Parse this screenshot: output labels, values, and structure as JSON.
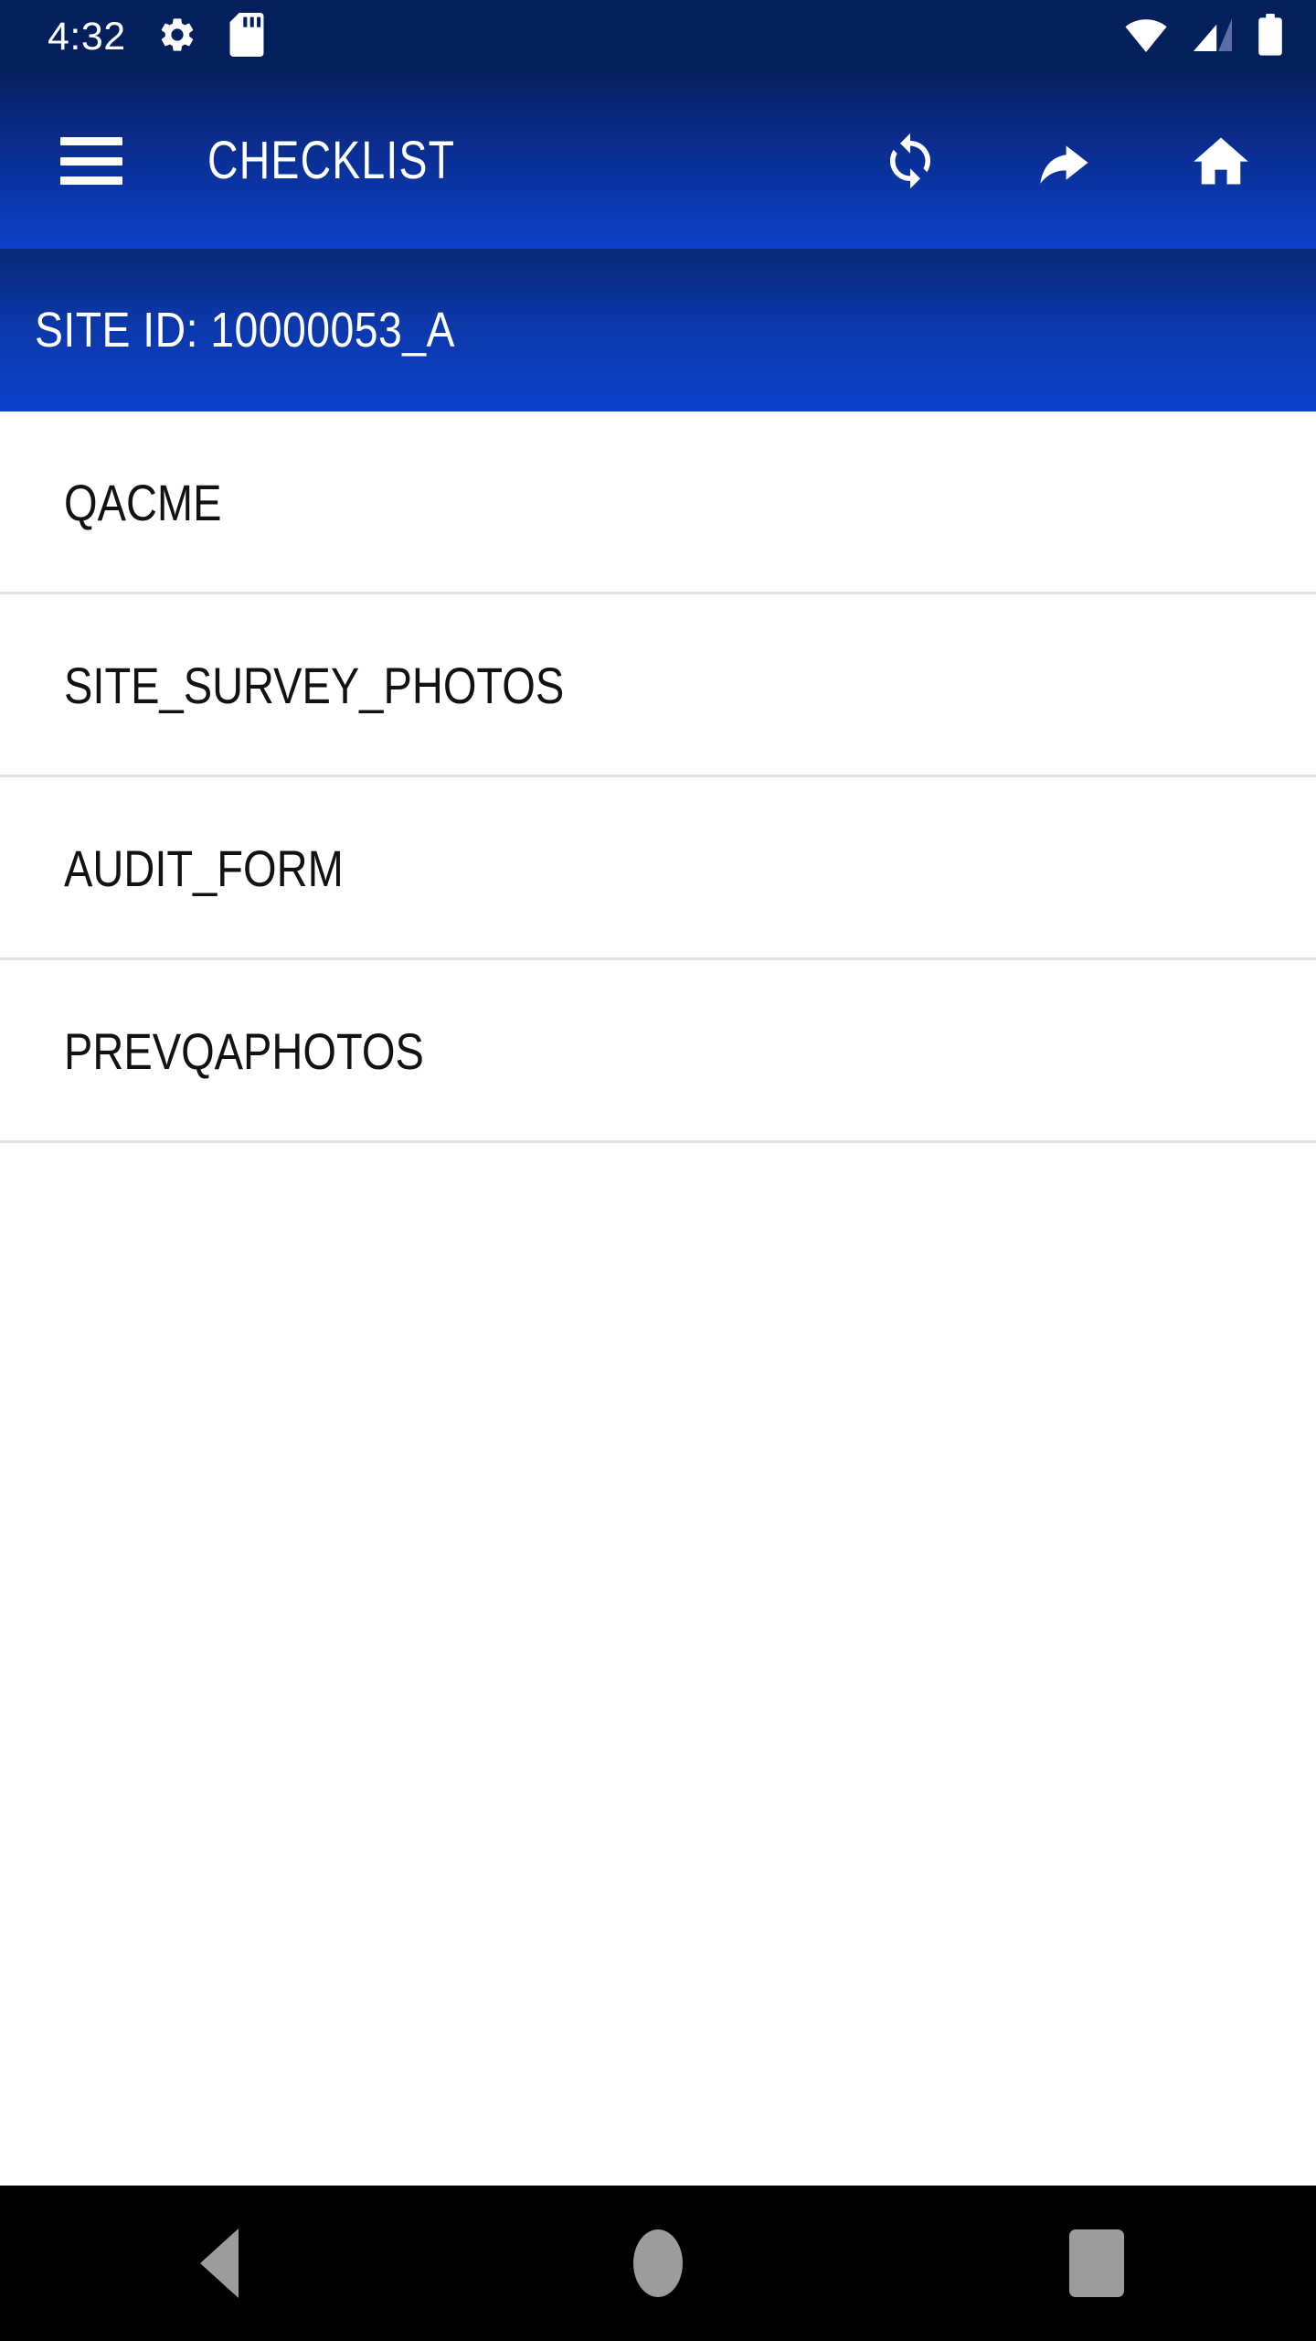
{
  "status_bar": {
    "time": "4:32",
    "left_icons": [
      {
        "name": "settings-gear-icon",
        "label": "Settings"
      },
      {
        "name": "sd-card-icon",
        "label": "SD card"
      }
    ],
    "right_icons": [
      {
        "name": "wifi-icon",
        "label": "Wi-Fi signal full"
      },
      {
        "name": "cellular-signal-icon",
        "label": "Mobile signal partial"
      },
      {
        "name": "battery-icon",
        "label": "Battery full"
      }
    ],
    "background_color": "#04205c"
  },
  "app_bar": {
    "title": "CHECKLIST",
    "menu_icon": "hamburger-menu-icon",
    "gradient_from": "#082060",
    "gradient_to": "#0c40c8",
    "actions": [
      {
        "name": "sync-icon",
        "label": "Sync"
      },
      {
        "name": "reply-back-arrow-icon",
        "label": "Back"
      },
      {
        "name": "home-icon",
        "label": "Home"
      }
    ]
  },
  "site_banner": {
    "label": "SITE ID: 10000053_A",
    "gradient_from": "#0a2a76",
    "gradient_to": "#0c41cc"
  },
  "checklist": {
    "items": [
      {
        "label": "QACME"
      },
      {
        "label": "SITE_SURVEY_PHOTOS"
      },
      {
        "label": "AUDIT_FORM"
      },
      {
        "label": "PREVQAPHOTOS"
      }
    ],
    "divider_color": "#e2e2e2",
    "text_color": "#121212"
  },
  "navigation_bar": {
    "background_color": "#000000",
    "icon_color": "#9c9c9c",
    "buttons": [
      {
        "name": "nav-back-button",
        "label": "Back"
      },
      {
        "name": "nav-home-button",
        "label": "Home"
      },
      {
        "name": "nav-recents-button",
        "label": "Recent apps"
      }
    ]
  }
}
